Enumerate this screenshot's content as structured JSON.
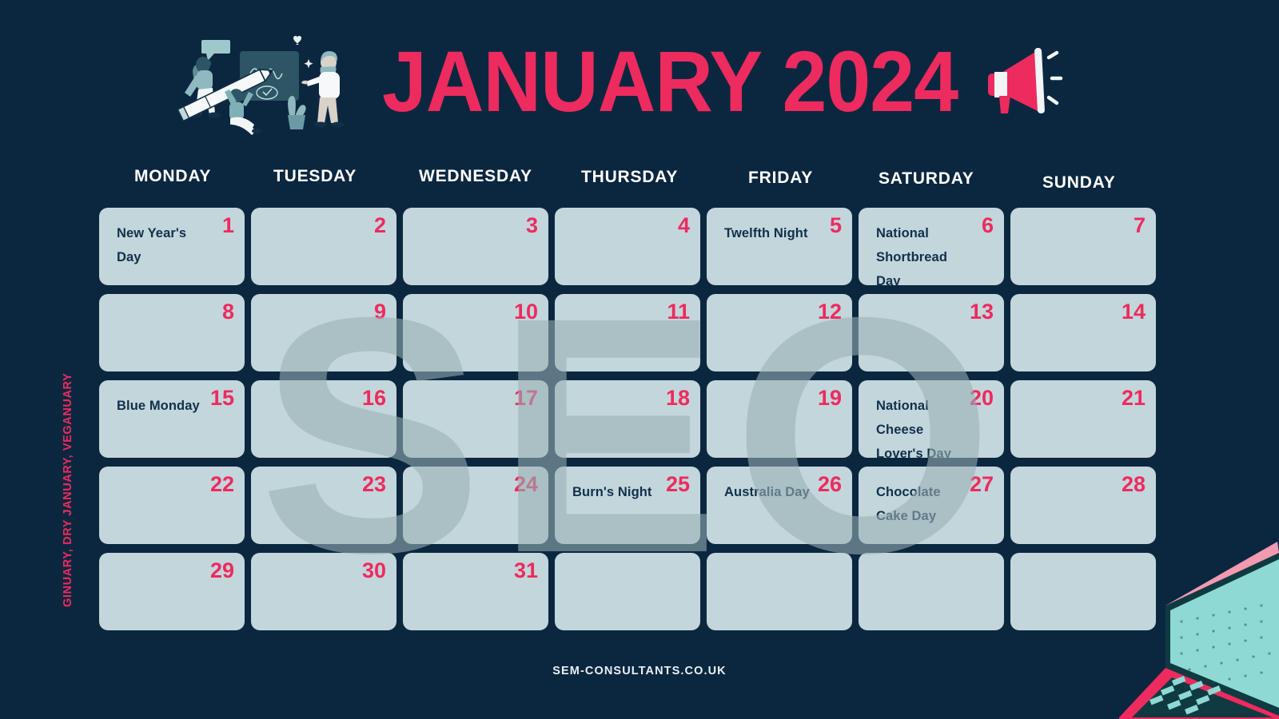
{
  "page": {
    "background_color": "#0b2740",
    "accent_color": "#ed2b5e",
    "cell_color": "#c3d6dc",
    "text_dark": "#11304a"
  },
  "header": {
    "title": "JANUARY 2024",
    "illustration_name": "team-whiteboard-pencil-illustration",
    "megaphone_name": "megaphone-icon"
  },
  "side_label": {
    "text": "GINUARY, DRY JANUARY, VEGANUARY"
  },
  "watermark": {
    "text": "SEO"
  },
  "weekdays": [
    {
      "label": "MONDAY"
    },
    {
      "label": "TUESDAY"
    },
    {
      "label": "WEDNESDAY"
    },
    {
      "label": "THURSDAY"
    },
    {
      "label": "FRIDAY"
    },
    {
      "label": "SATURDAY"
    },
    {
      "label": "SUNDAY"
    }
  ],
  "days": [
    {
      "num": "1",
      "event": "New Year's Day"
    },
    {
      "num": "2",
      "event": ""
    },
    {
      "num": "3",
      "event": ""
    },
    {
      "num": "4",
      "event": ""
    },
    {
      "num": "5",
      "event": "Twelfth Night"
    },
    {
      "num": "6",
      "event": "National Shortbread Day"
    },
    {
      "num": "7",
      "event": ""
    },
    {
      "num": "8",
      "event": ""
    },
    {
      "num": "9",
      "event": ""
    },
    {
      "num": "10",
      "event": ""
    },
    {
      "num": "11",
      "event": ""
    },
    {
      "num": "12",
      "event": ""
    },
    {
      "num": "13",
      "event": ""
    },
    {
      "num": "14",
      "event": ""
    },
    {
      "num": "15",
      "event": "Blue Monday"
    },
    {
      "num": "16",
      "event": ""
    },
    {
      "num": "17",
      "event": ""
    },
    {
      "num": "18",
      "event": ""
    },
    {
      "num": "19",
      "event": ""
    },
    {
      "num": "20",
      "event": "National Cheese Lover's Day"
    },
    {
      "num": "21",
      "event": ""
    },
    {
      "num": "22",
      "event": ""
    },
    {
      "num": "23",
      "event": ""
    },
    {
      "num": "24",
      "event": ""
    },
    {
      "num": "25",
      "event": "Burn's Night"
    },
    {
      "num": "26",
      "event": "Australia Day"
    },
    {
      "num": "27",
      "event": "Chocolate Cake Day"
    },
    {
      "num": "28",
      "event": ""
    },
    {
      "num": "29",
      "event": ""
    },
    {
      "num": "30",
      "event": ""
    },
    {
      "num": "31",
      "event": ""
    },
    {
      "num": "",
      "event": ""
    },
    {
      "num": "",
      "event": ""
    },
    {
      "num": "",
      "event": ""
    },
    {
      "num": "",
      "event": ""
    }
  ],
  "footer": {
    "text": "SEM-CONSULTANTS.CO.UK"
  },
  "decor": {
    "laptop_name": "laptop-illustration"
  }
}
